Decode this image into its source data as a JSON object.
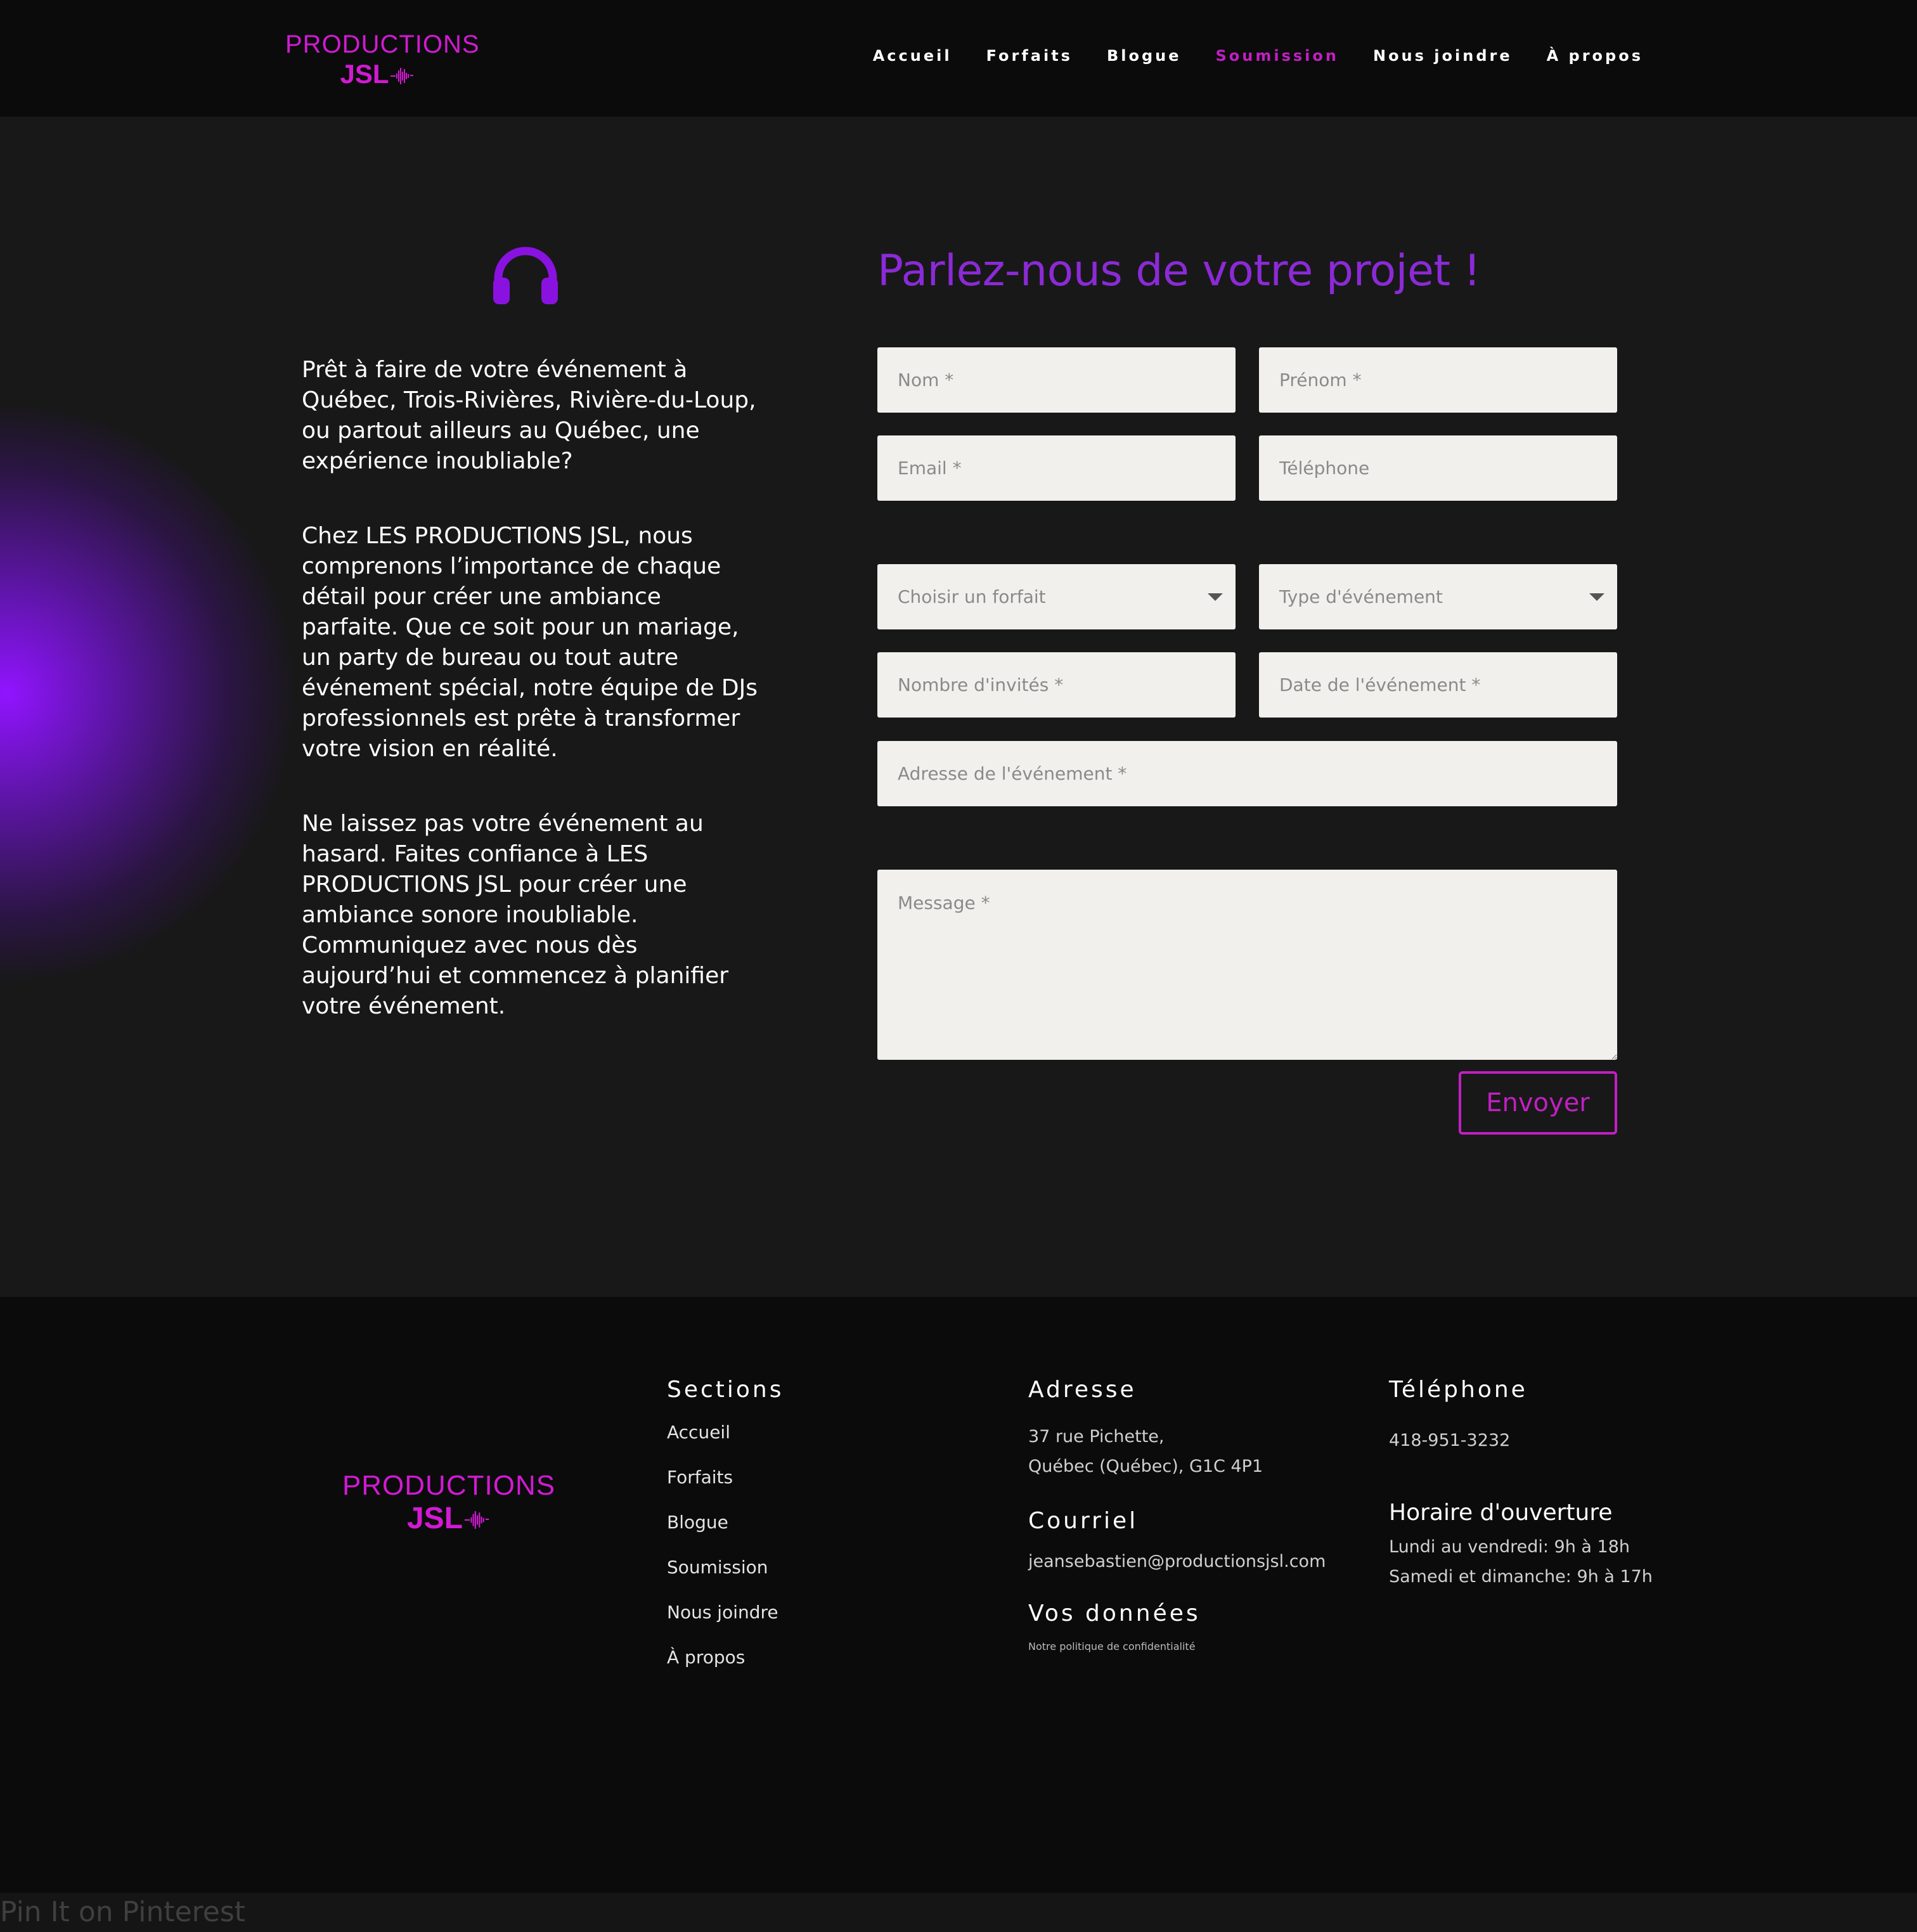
{
  "brand": {
    "line1": "PRODUCTIONS",
    "line2": "JSL",
    "color": "#d21ad2"
  },
  "nav": {
    "items": [
      {
        "label": "Accueil",
        "active": false
      },
      {
        "label": "Forfaits",
        "active": false
      },
      {
        "label": "Blogue",
        "active": false
      },
      {
        "label": "Soumission",
        "active": true
      },
      {
        "label": "Nous joindre",
        "active": false
      },
      {
        "label": "À propos",
        "active": false
      }
    ],
    "active_color": "#c21fc2"
  },
  "intro": {
    "icon": "headphones-icon",
    "icon_color": "#8a12e0",
    "paragraphs": [
      "Prêt à faire de votre événement à Québec, Trois-Rivières, Rivière-du-Loup, ou partout ailleurs au Québec, une expérience inoubliable?",
      "Chez LES PRODUCTIONS JSL, nous comprenons l’importance de chaque détail pour créer une ambiance parfaite. Que ce soit pour un mariage, un party de bureau ou tout autre événement spécial, notre équipe de DJs professionnels est prête à transformer votre vision en réalité.",
      "Ne laissez pas votre événement au hasard. Faites confiance à LES PRODUCTIONS JSL pour créer une ambiance sonore inoubliable. Communiquez avec nous dès aujourd’hui et commencez à planifier votre événement."
    ]
  },
  "form": {
    "title": "Parlez-nous de votre projet !",
    "title_color": "#8b2ad6",
    "nom": "Nom *",
    "prenom": "Prénom *",
    "email": "Email *",
    "telephone": "Téléphone",
    "forfait": "Choisir un forfait",
    "type_evenement": "Type d'événement",
    "nombre_invites": "Nombre d'invités *",
    "date_evenement": "Date de l'événement *",
    "adresse_evenement": "Adresse de l'événement *",
    "message": "Message *",
    "submit": "Envoyer"
  },
  "footer": {
    "sections": {
      "title": "Sections",
      "links": [
        "Accueil",
        "Forfaits",
        "Blogue",
        "Soumission",
        "Nous joindre",
        "À propos"
      ]
    },
    "adresse": {
      "title": "Adresse",
      "line1": "37 rue Pichette,",
      "line2": "Québec (Québec), G1C 4P1"
    },
    "courriel": {
      "title": "Courriel",
      "email": "jeansebastien@productionsjsl.com"
    },
    "donnees": {
      "title": "Vos données",
      "link": "Notre politique de confidentialité"
    },
    "telephone": {
      "title": "Téléphone",
      "number": "418-951-3232"
    },
    "horaire": {
      "title": "Horaire d'ouverture",
      "line1": "Lundi au vendredi: 9h à 18h",
      "line2": "Samedi et dimanche: 9h à 17h"
    }
  },
  "pinterest": "Pin It on Pinterest"
}
